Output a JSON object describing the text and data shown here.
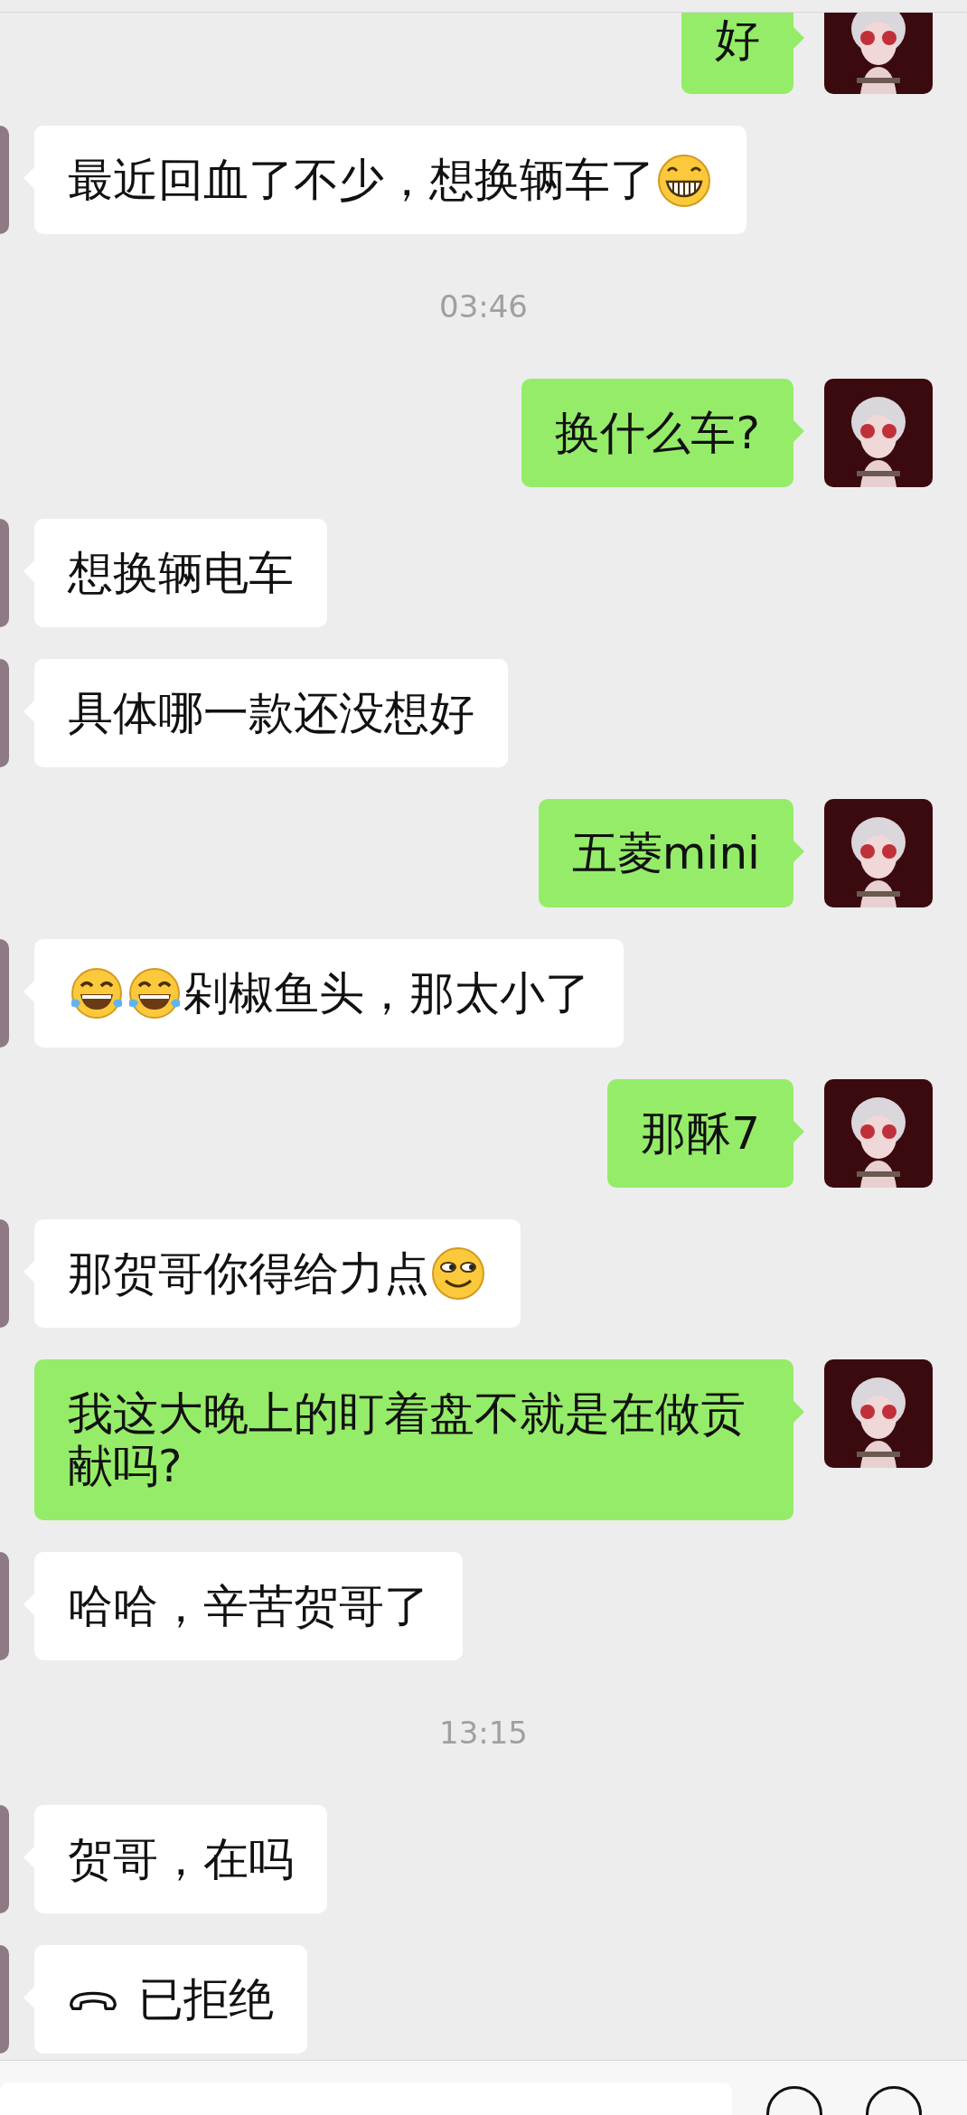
{
  "messages": [
    {
      "kind": "message",
      "outgoing": true,
      "parts": [
        {
          "kind": "text",
          "text": "好"
        }
      ]
    },
    {
      "kind": "message",
      "outgoing": false,
      "parts": [
        {
          "kind": "text",
          "text": "最近回血了不少，想换辆车了"
        },
        {
          "kind": "grin"
        }
      ]
    },
    {
      "kind": "time",
      "text": "03:46"
    },
    {
      "kind": "message",
      "outgoing": true,
      "parts": [
        {
          "kind": "text",
          "text": "换什么车?"
        }
      ]
    },
    {
      "kind": "message",
      "outgoing": false,
      "parts": [
        {
          "kind": "text",
          "text": "想换辆电车"
        }
      ]
    },
    {
      "kind": "message",
      "outgoing": false,
      "parts": [
        {
          "kind": "text",
          "text": "具体哪一款还没想好"
        }
      ]
    },
    {
      "kind": "message",
      "outgoing": true,
      "parts": [
        {
          "kind": "text",
          "text": "五菱mini"
        }
      ]
    },
    {
      "kind": "message",
      "outgoing": false,
      "parts": [
        {
          "kind": "tears-of-joy"
        },
        {
          "kind": "tears-of-joy"
        },
        {
          "kind": "text",
          "text": "剁椒鱼头，那太小了"
        }
      ]
    },
    {
      "kind": "message",
      "outgoing": true,
      "parts": [
        {
          "kind": "text",
          "text": "那酥7"
        }
      ]
    },
    {
      "kind": "message",
      "outgoing": false,
      "parts": [
        {
          "kind": "text",
          "text": "那贺哥你得给力点"
        },
        {
          "kind": "smirk"
        }
      ]
    },
    {
      "kind": "message",
      "outgoing": true,
      "parts": [
        {
          "kind": "text",
          "text": "我这大晚上的盯着盘不就是在做贡献吗?"
        }
      ]
    },
    {
      "kind": "message",
      "outgoing": false,
      "parts": [
        {
          "kind": "text",
          "text": "哈哈，辛苦贺哥了"
        }
      ]
    },
    {
      "kind": "time",
      "text": "13:15"
    },
    {
      "kind": "message",
      "outgoing": false,
      "parts": [
        {
          "kind": "text",
          "text": "贺哥，在吗"
        }
      ]
    },
    {
      "kind": "message",
      "outgoing": false,
      "parts": [
        {
          "kind": "call"
        },
        {
          "kind": "text",
          "text": "已拒绝"
        }
      ]
    }
  ]
}
